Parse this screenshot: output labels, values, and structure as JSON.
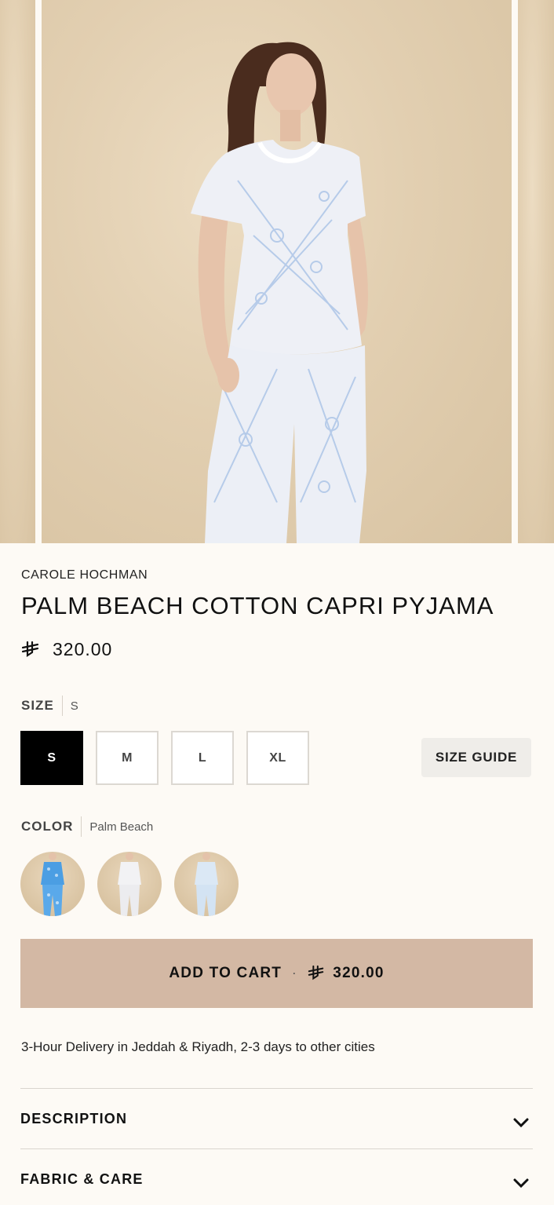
{
  "gallery": {
    "images": [
      "product-image-prev",
      "product-image-main",
      "product-image-next"
    ]
  },
  "product": {
    "brand": "CAROLE HOCHMAN",
    "title": "PALM BEACH COTTON CAPRI PYJAMA",
    "price": "320.00",
    "currency_icon": "riyal-icon"
  },
  "size": {
    "label": "SIZE",
    "selected": "S",
    "options": [
      "S",
      "M",
      "L",
      "XL"
    ],
    "guide_label": "SIZE GUIDE"
  },
  "color": {
    "label": "COLOR",
    "selected": "Palm Beach",
    "swatch_icons": [
      "blue-print-swatch",
      "white-swatch",
      "light-blue-swatch"
    ]
  },
  "cart": {
    "label": "ADD TO CART",
    "separator": "·",
    "price": "320.00",
    "bg": "#d3b8a4"
  },
  "delivery_text": "3-Hour Delivery in Jeddah & Riyadh, 2-3 days to other cities",
  "accordions": [
    {
      "label": "DESCRIPTION",
      "icon": "chevron-down-icon"
    },
    {
      "label": "FABRIC & CARE",
      "icon": "chevron-down-icon"
    }
  ]
}
